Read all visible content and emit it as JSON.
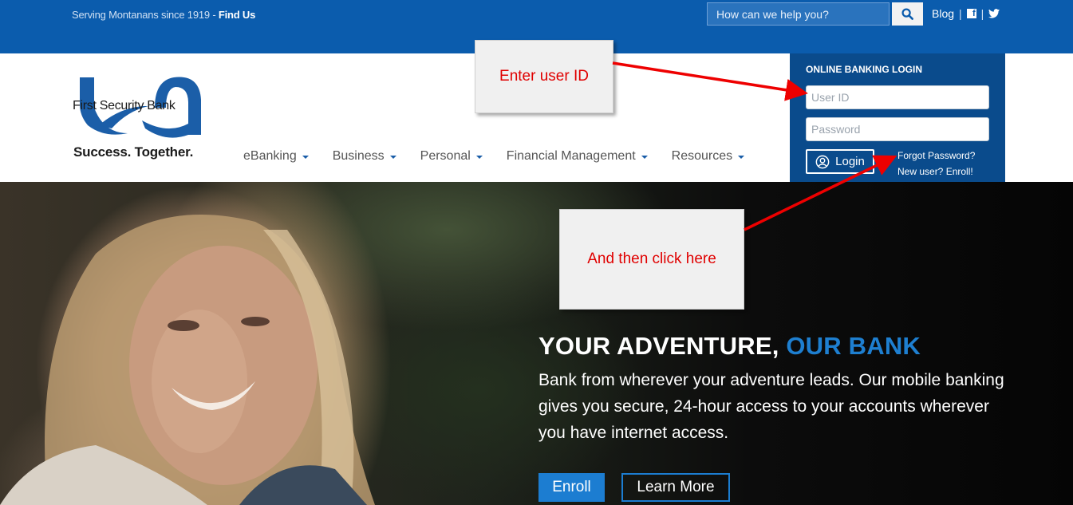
{
  "topbar": {
    "tagline": "Serving Montanans since 1919 - ",
    "find_us": "Find Us",
    "search_placeholder": "How can we help you?",
    "blog": "Blog",
    "sep": "|",
    "facebook_glyph": "f"
  },
  "brand": {
    "name": "First Security Bank",
    "slogan": "Success. Together.",
    "color": "#1b5ea8"
  },
  "nav": {
    "items": [
      {
        "label": "eBanking"
      },
      {
        "label": "Business"
      },
      {
        "label": "Personal"
      },
      {
        "label": "Financial Management"
      },
      {
        "label": "Resources"
      }
    ]
  },
  "login": {
    "title": "ONLINE BANKING LOGIN",
    "user_placeholder": "User ID",
    "password_placeholder": "Password",
    "button": "Login",
    "forgot": "Forgot Password?",
    "enroll": "New user? Enroll!"
  },
  "hero": {
    "title_main": "YOUR ADVENTURE, ",
    "title_accent": "OUR BANK",
    "text": "Bank from wherever your adventure leads. Our mobile banking gives you secure, 24-hour access to your accounts wherever you have internet access.",
    "enroll": "Enroll",
    "learn_more": "Learn More"
  },
  "annotations": {
    "step1": "Enter user ID",
    "step2": "And then click here",
    "color": "#e00000"
  },
  "colors": {
    "topbar": "#0b5cad",
    "login_panel": "#0a4b8c",
    "accent": "#1e7fd0"
  }
}
